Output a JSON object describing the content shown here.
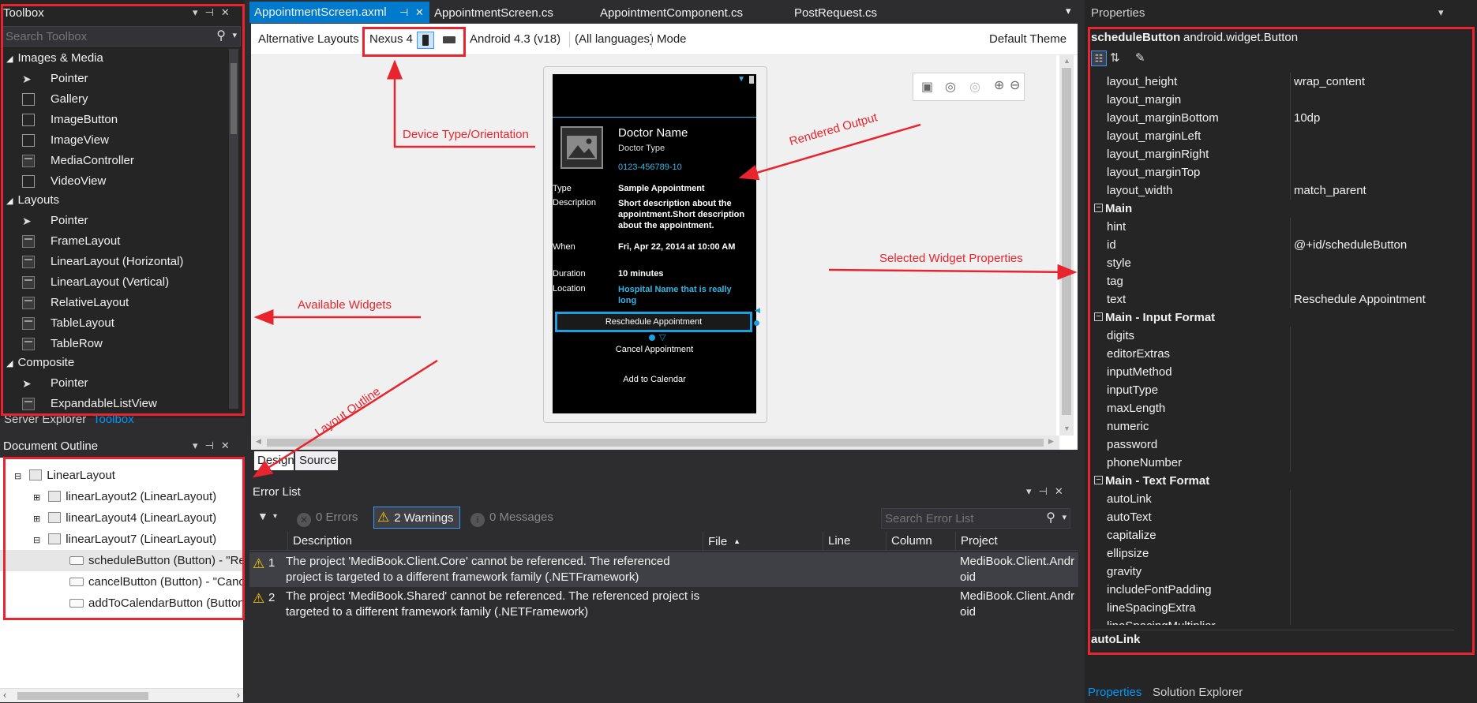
{
  "toolbox": {
    "title": "Toolbox",
    "search_placeholder": "Search Toolbox",
    "groups": [
      {
        "label": "Images & Media",
        "items": [
          "Pointer",
          "Gallery",
          "ImageButton",
          "ImageView",
          "MediaController",
          "VideoView"
        ]
      },
      {
        "label": "Layouts",
        "items": [
          "Pointer",
          "FrameLayout",
          "LinearLayout (Horizontal)",
          "LinearLayout (Vertical)",
          "RelativeLayout",
          "TableLayout",
          "TableRow"
        ]
      },
      {
        "label": "Composite",
        "items": [
          "Pointer",
          "ExpandableListView"
        ]
      }
    ],
    "bottom_tabs": [
      "Server Explorer",
      "Toolbox"
    ]
  },
  "outline": {
    "title": "Document Outline",
    "items": [
      {
        "label": "LinearLayout"
      },
      {
        "label": "linearLayout2 (LinearLayout)"
      },
      {
        "label": "linearLayout4 (LinearLayout)"
      },
      {
        "label": "linearLayout7 (LinearLayout)"
      },
      {
        "label": "scheduleButton (Button) - \"Re"
      },
      {
        "label": "cancelButton (Button) - \"Canc"
      },
      {
        "label": "addToCalendarButton (Button"
      }
    ]
  },
  "tabs": [
    {
      "label": "AppointmentScreen.axml",
      "pin": "⊣",
      "close": "✕"
    },
    {
      "label": "AppointmentScreen.cs"
    },
    {
      "label": "AppointmentComponent.cs"
    },
    {
      "label": "PostRequest.cs"
    }
  ],
  "designer_toolbar": {
    "alt_layouts": "Alternative Layouts",
    "device": "Nexus 4",
    "api": "Android 4.3 (v18)",
    "languages": "(All languages)",
    "mode": "Mode",
    "theme": "Default Theme"
  },
  "phone": {
    "doctor_name": "Doctor Name",
    "doctor_type": "Doctor Type",
    "phone_number": "0123-456789-10",
    "rows": [
      {
        "label": "Type",
        "value": "Sample Appointment"
      },
      {
        "label": "Description",
        "value": "Short description about the appointment.Short description about the appointment."
      },
      {
        "label": "When",
        "value": "Fri, Apr 22, 2014 at 10:00 AM"
      },
      {
        "label": "Duration",
        "value": "10 minutes"
      },
      {
        "label": "Location",
        "value": "Hospital Name that is really long"
      }
    ],
    "reschedule": "Reschedule Appointment",
    "cancel": "Cancel Appointment",
    "add_calendar": "Add to Calendar"
  },
  "view_tabs": [
    "Design",
    "Source"
  ],
  "annotations": {
    "device": "Device Type/Orientation",
    "rendered": "Rendered Output",
    "selected": "Selected Widget Properties",
    "widgets": "Available Widgets",
    "outline": "Layout Outline"
  },
  "error_list": {
    "title": "Error List",
    "errors": "0 Errors",
    "warnings": "2 Warnings",
    "messages": "0 Messages",
    "search_placeholder": "Search Error List",
    "columns": [
      "Description",
      "File",
      "Line",
      "Column",
      "Project"
    ],
    "rows": [
      {
        "num": "1",
        "desc1": "The project 'MediBook.Client.Core' cannot be referenced. The referenced",
        "desc2": "project is targeted to a different framework family (.NETFramework)",
        "proj1": "MediBook.Client.Andr",
        "proj2": "oid"
      },
      {
        "num": "2",
        "desc1": "The project 'MediBook.Shared' cannot be referenced. The referenced project is",
        "desc2": "targeted to a different framework family (.NETFramework)",
        "proj1": "MediBook.Client.Andr",
        "proj2": "oid"
      }
    ]
  },
  "properties": {
    "title": "Properties",
    "widget_id": "scheduleButton",
    "widget_type": "android.widget.Button",
    "rows_top": [
      {
        "name": "layout_height",
        "value": "wrap_content"
      },
      {
        "name": "layout_margin",
        "value": ""
      },
      {
        "name": "layout_marginBottom",
        "value": "10dp"
      },
      {
        "name": "layout_marginLeft",
        "value": ""
      },
      {
        "name": "layout_marginRight",
        "value": ""
      },
      {
        "name": "layout_marginTop",
        "value": ""
      },
      {
        "name": "layout_width",
        "value": "match_parent"
      }
    ],
    "cat_main": "Main",
    "rows_main": [
      {
        "name": "hint",
        "value": ""
      },
      {
        "name": "id",
        "value": "@+id/scheduleButton"
      },
      {
        "name": "style",
        "value": ""
      },
      {
        "name": "tag",
        "value": ""
      },
      {
        "name": "text",
        "value": "Reschedule Appointment"
      }
    ],
    "cat_input": "Main - Input Format",
    "rows_input": [
      {
        "name": "digits"
      },
      {
        "name": "editorExtras"
      },
      {
        "name": "inputMethod"
      },
      {
        "name": "inputType"
      },
      {
        "name": "maxLength"
      },
      {
        "name": "numeric"
      },
      {
        "name": "password"
      },
      {
        "name": "phoneNumber"
      }
    ],
    "cat_text": "Main - Text Format",
    "rows_text": [
      {
        "name": "autoLink"
      },
      {
        "name": "autoText"
      },
      {
        "name": "capitalize"
      },
      {
        "name": "ellipsize"
      },
      {
        "name": "gravity"
      },
      {
        "name": "includeFontPadding"
      },
      {
        "name": "lineSpacingExtra"
      },
      {
        "name": "lineSpacingMultiplier"
      }
    ],
    "description": "autoLink",
    "bottom_tabs": [
      "Properties",
      "Solution Explorer"
    ]
  },
  "colors": {
    "accent": "#007acc",
    "annotation": "#e8242e",
    "warning": "#ffcc00",
    "link": "#1ba1e2"
  }
}
